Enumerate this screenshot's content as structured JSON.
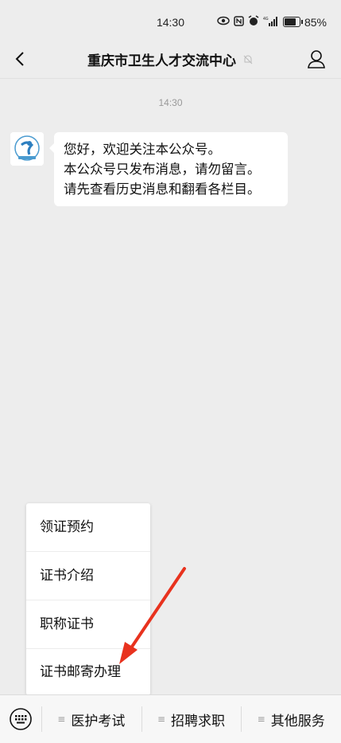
{
  "status_bar": {
    "time": "14:30",
    "battery": "85%",
    "icons": [
      "eye-icon",
      "nfc-icon",
      "alarm-icon",
      "signal-4g-icon",
      "battery-icon"
    ]
  },
  "nav": {
    "title": "重庆市卫生人才交流中心",
    "back_icon": "chevron-left-icon",
    "mute_icon": "bell-muted-icon",
    "profile_icon": "person-icon"
  },
  "chat": {
    "timestamp": "14:30",
    "message_lines": [
      "您好，欢迎关注本公众号。",
      "本公众号只发布消息，请勿留言。",
      "请先查看历史消息和翻看各栏目。"
    ]
  },
  "popup_menu": {
    "items": [
      "领证预约",
      "证书介绍",
      "职称证书",
      "证书邮寄办理"
    ]
  },
  "bottom_menu": {
    "keyboard_icon": "keyboard-icon",
    "tabs": [
      {
        "label": "医护考试",
        "icon": "≡"
      },
      {
        "label": "招聘求职",
        "icon": "≡"
      },
      {
        "label": "其他服务",
        "icon": "≡"
      }
    ]
  },
  "colors": {
    "background": "#ededed",
    "bubble": "#ffffff",
    "arrow": "#e8321e"
  }
}
